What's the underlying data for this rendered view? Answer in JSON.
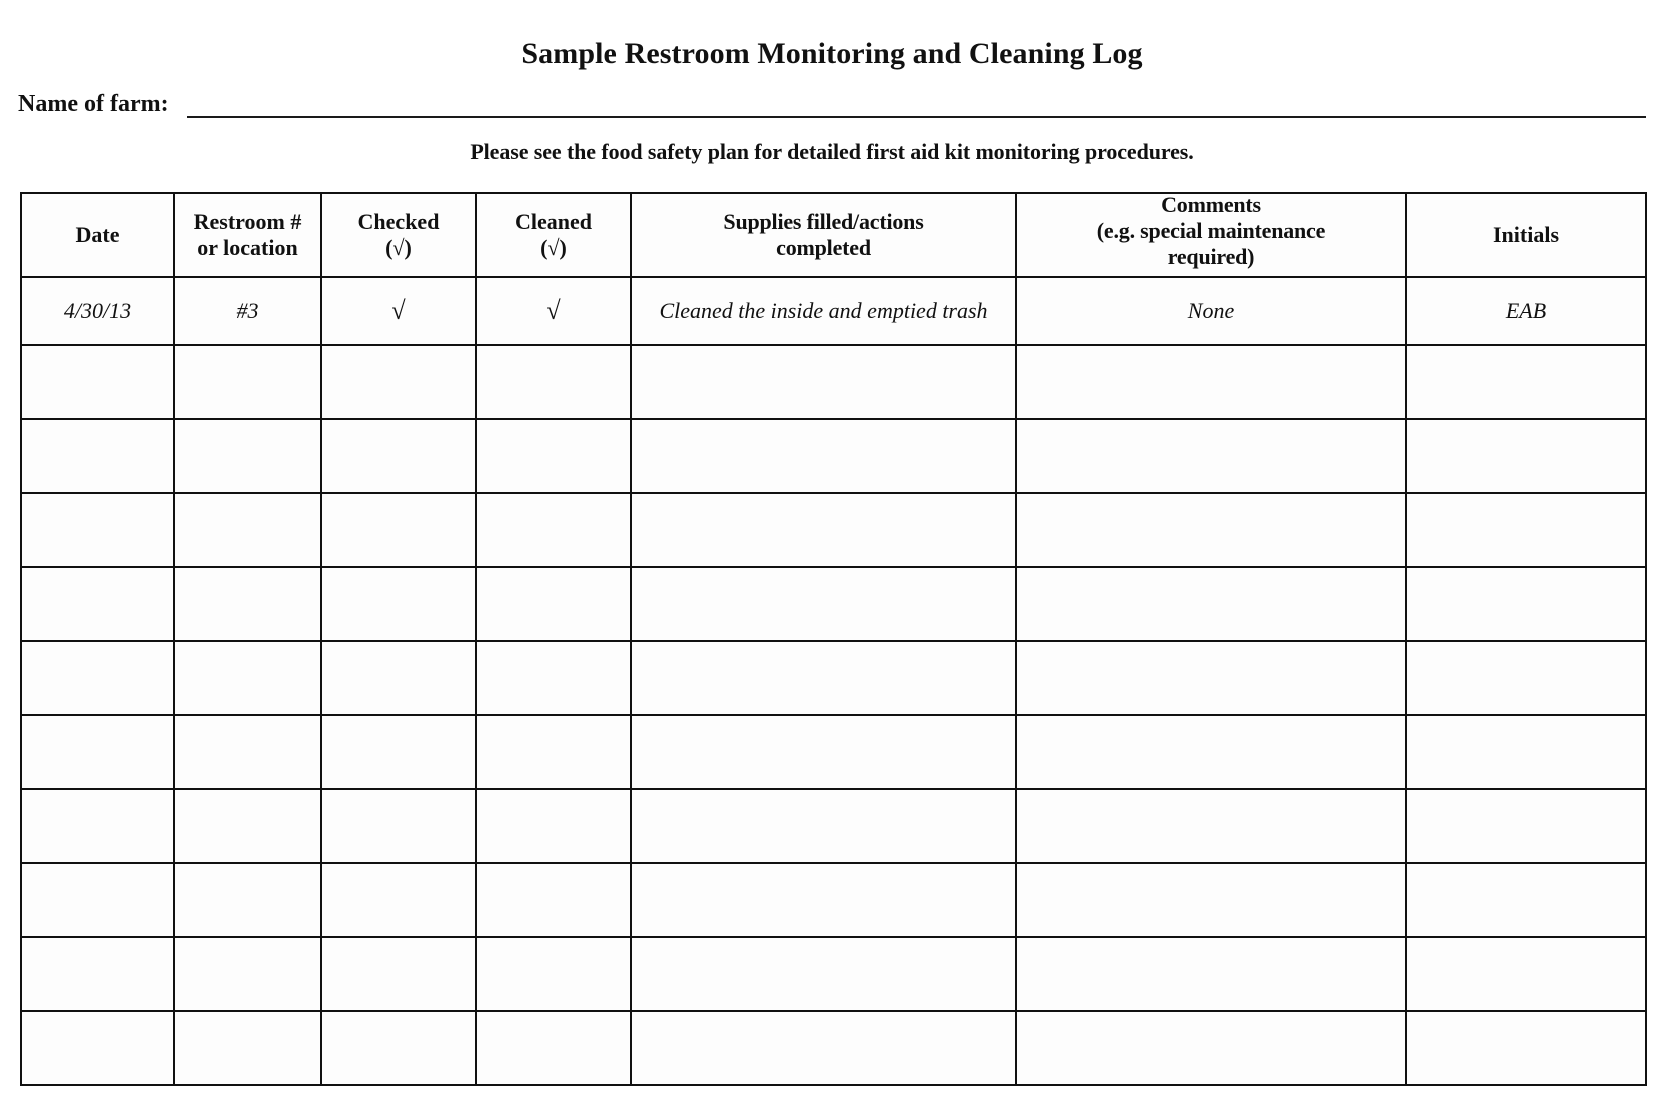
{
  "document": {
    "title": "Sample Restroom Monitoring and Cleaning Log",
    "farm_label": "Name of farm:",
    "instruction": "Please see the food safety plan for detailed first aid kit monitoring procedures."
  },
  "table": {
    "headers": [
      {
        "line1": "Date",
        "line2": "",
        "line3": ""
      },
      {
        "line1": "Restroom #",
        "line2": "or location",
        "line3": ""
      },
      {
        "line1": "Checked",
        "line2": "(√)",
        "line3": ""
      },
      {
        "line1": "Cleaned",
        "line2": "(√)",
        "line3": ""
      },
      {
        "line1": "Supplies filled/actions",
        "line2": "completed",
        "line3": ""
      },
      {
        "line1": "Comments",
        "line2": "(e.g. special maintenance",
        "line3": "required)"
      },
      {
        "line1": "Initials",
        "line2": "",
        "line3": ""
      }
    ],
    "rows": [
      {
        "date": "4/30/13",
        "restroom": "#3",
        "checked": "√",
        "cleaned": "√",
        "supplies": "Cleaned the inside and emptied trash",
        "comments": "None",
        "initials": "EAB"
      },
      {
        "date": "",
        "restroom": "",
        "checked": "",
        "cleaned": "",
        "supplies": "",
        "comments": "",
        "initials": ""
      },
      {
        "date": "",
        "restroom": "",
        "checked": "",
        "cleaned": "",
        "supplies": "",
        "comments": "",
        "initials": ""
      },
      {
        "date": "",
        "restroom": "",
        "checked": "",
        "cleaned": "",
        "supplies": "",
        "comments": "",
        "initials": ""
      },
      {
        "date": "",
        "restroom": "",
        "checked": "",
        "cleaned": "",
        "supplies": "",
        "comments": "",
        "initials": ""
      },
      {
        "date": "",
        "restroom": "",
        "checked": "",
        "cleaned": "",
        "supplies": "",
        "comments": "",
        "initials": ""
      },
      {
        "date": "",
        "restroom": "",
        "checked": "",
        "cleaned": "",
        "supplies": "",
        "comments": "",
        "initials": ""
      },
      {
        "date": "",
        "restroom": "",
        "checked": "",
        "cleaned": "",
        "supplies": "",
        "comments": "",
        "initials": ""
      },
      {
        "date": "",
        "restroom": "",
        "checked": "",
        "cleaned": "",
        "supplies": "",
        "comments": "",
        "initials": ""
      },
      {
        "date": "",
        "restroom": "",
        "checked": "",
        "cleaned": "",
        "supplies": "",
        "comments": "",
        "initials": ""
      },
      {
        "date": "",
        "restroom": "",
        "checked": "",
        "cleaned": "",
        "supplies": "",
        "comments": "",
        "initials": ""
      }
    ]
  },
  "colors": {
    "ink": "#111111",
    "paper": "#ffffff"
  }
}
